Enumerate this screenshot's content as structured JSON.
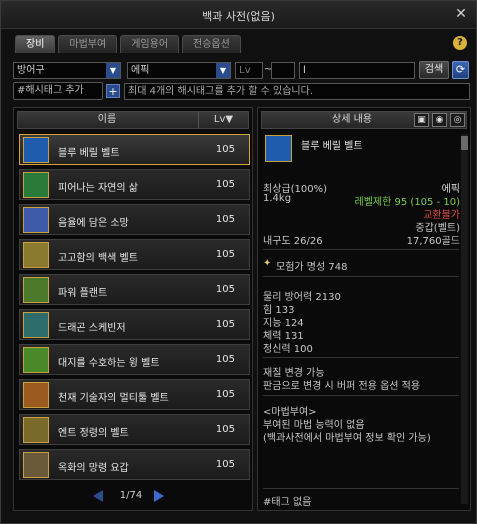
{
  "window": {
    "title": "백과 사전(없음)"
  },
  "tabs": [
    {
      "label": "장비",
      "active": true
    },
    {
      "label": "마법부여",
      "active": false
    },
    {
      "label": "게임용어",
      "active": false
    },
    {
      "label": "전승옵션",
      "active": false
    }
  ],
  "filters": {
    "category_value": "방어구",
    "rarity_value": "에픽",
    "lv_label": "Lv",
    "range_sep": "~",
    "search_value": "l",
    "search_button": "검색"
  },
  "hashtag": {
    "button_label": "#해시태그 추가",
    "placeholder": "최대 4개의 해시태그를 추가 할 수 있습니다."
  },
  "list": {
    "col_name": "이름",
    "col_lv": "Lv▼",
    "items": [
      {
        "name": "블루 베릴 벨트",
        "lv": "105",
        "selected": true,
        "color": "#1f5cae"
      },
      {
        "name": "피어나는 자연의 삶",
        "lv": "105",
        "selected": false,
        "color": "#2a7a3a"
      },
      {
        "name": "음율에 담은 소망",
        "lv": "105",
        "selected": false,
        "color": "#3f5aa8"
      },
      {
        "name": "고고함의 백색 벨트",
        "lv": "105",
        "selected": false,
        "color": "#8a7a30"
      },
      {
        "name": "파워 플랜트",
        "lv": "105",
        "selected": false,
        "color": "#4a7a2a"
      },
      {
        "name": "드래곤 스케빈저",
        "lv": "105",
        "selected": false,
        "color": "#2e6b6b"
      },
      {
        "name": "대지를 수호하는 윙 벨트",
        "lv": "105",
        "selected": false,
        "color": "#4a8a2a"
      },
      {
        "name": "천재 기술자의 멀티툴 벨트",
        "lv": "105",
        "selected": false,
        "color": "#9a5a20"
      },
      {
        "name": "엔트 정령의 벨트",
        "lv": "105",
        "selected": false,
        "color": "#7a6a2a"
      },
      {
        "name": "옥화의 망령 요갑",
        "lv": "105",
        "selected": false,
        "color": "#6a5a3a"
      }
    ]
  },
  "pager": {
    "text": "1/74"
  },
  "detail": {
    "header": "상세 내용",
    "item_name": "블루 베릴 벨트",
    "grade": "최상급(100%)",
    "rarity": "에픽",
    "weight": "1.4kg",
    "level_req": "레벨제한 95 (105 - 10)",
    "tradable": "교환불가",
    "type": "중갑(벨트)",
    "durability": "내구도 26/26",
    "price": "17,760골드",
    "fame": "모험가 명성 748",
    "stats": [
      "물리 방어력 2130",
      "힘 133",
      "지능 124",
      "체력 131",
      "정신력 100"
    ],
    "notes": [
      "재질 변경 가능",
      "판금으로 변경 시 버퍼 전용 옵션 적용"
    ],
    "enchant_header": "<마법부여>",
    "enchant_lines": [
      "부여된 마법 능력이 없음",
      "(백과사전에서 마법부여 정보 확인 가능)"
    ],
    "tag_text": "#태그 없음"
  }
}
